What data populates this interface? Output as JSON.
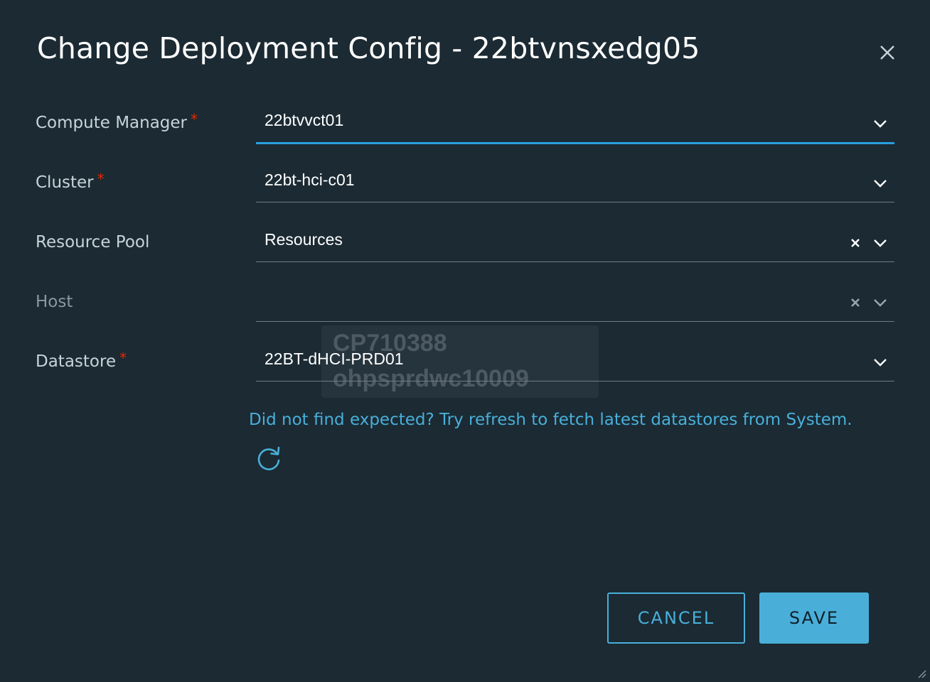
{
  "dialog": {
    "title": "Change Deployment Config - 22btvnsxedg05",
    "close_icon": "close-icon"
  },
  "fields": {
    "compute_manager": {
      "label": "Compute Manager",
      "required": true,
      "value": "22btvvct01"
    },
    "cluster": {
      "label": "Cluster",
      "required": true,
      "value": "22bt-hci-c01"
    },
    "resource_pool": {
      "label": "Resource Pool",
      "required": false,
      "value": "Resources"
    },
    "host": {
      "label": "Host",
      "required": false,
      "value": ""
    },
    "datastore": {
      "label": "Datastore",
      "required": true,
      "value": "22BT-dHCI-PRD01"
    }
  },
  "required_marker": "*",
  "hint": "Did not find expected? Try refresh to fetch latest datastores from System.",
  "watermark": {
    "line1": "CP710388",
    "line2": "ohpsprdwc10009"
  },
  "buttons": {
    "cancel": "CANCEL",
    "save": "SAVE"
  },
  "colors": {
    "background": "#1b2a33",
    "accent": "#49afd9",
    "active_underline": "#2b9ee0",
    "required": "#e62700"
  },
  "icons": [
    "close-icon",
    "chevron-down-icon",
    "clear-icon",
    "refresh-icon",
    "resize-handle-icon"
  ]
}
